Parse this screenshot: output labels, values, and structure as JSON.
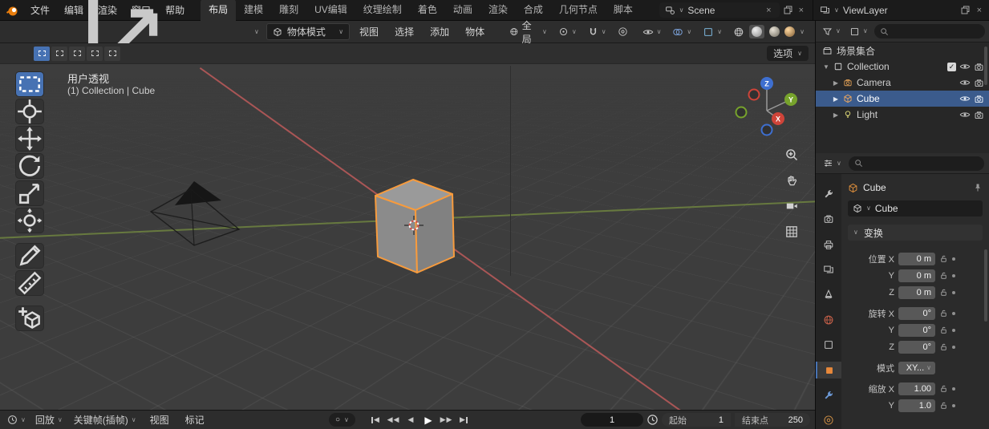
{
  "colors": {
    "accent": "#4772b3",
    "object_orange": "#e8883a",
    "selection_outline": "#f79b3d",
    "axis_x": "#cf4439",
    "axis_y": "#77a32c",
    "axis_z": "#3e6fd0"
  },
  "icons": {
    "chevron": "∨",
    "caret_open": "▼",
    "caret_closed": "▶",
    "close": "×",
    "check": "✓",
    "circle": "○",
    "tri_left": "◀",
    "tri_right": "▶"
  },
  "topbar": {
    "menus": [
      "文件",
      "编辑",
      "渲染",
      "窗口",
      "帮助"
    ],
    "tabs": [
      "布局",
      "建模",
      "雕刻",
      "UV编辑",
      "纹理绘制",
      "着色",
      "动画",
      "渲染",
      "合成",
      "几何节点",
      "脚本"
    ],
    "active_tab": "布局",
    "scene_label": "Scene",
    "viewlayer_label": "ViewLayer"
  },
  "toolbar": {
    "mode_label": "物体模式",
    "menus": [
      "视图",
      "选择",
      "添加",
      "物体"
    ],
    "orientation_label": "全局"
  },
  "viewport": {
    "title": "用户透视",
    "subtitle": "(1) Collection | Cube",
    "options_label": "选项",
    "axis_labels": {
      "x": "X",
      "y": "Y",
      "z": "Z"
    }
  },
  "outliner": {
    "scene_collection": "场景集合",
    "items": [
      {
        "label": "Collection"
      },
      {
        "label": "Camera"
      },
      {
        "label": "Cube",
        "selected": true
      },
      {
        "label": "Light"
      }
    ]
  },
  "properties": {
    "breadcrumb": "Cube",
    "name_value": "Cube",
    "transform_section": "变换",
    "rows": [
      {
        "label": "位置 X",
        "value": "0 m"
      },
      {
        "label": "Y",
        "value": "0 m"
      },
      {
        "label": "Z",
        "value": "0 m"
      },
      {
        "label": "旋转 X",
        "value": "0°"
      },
      {
        "label": "Y",
        "value": "0°"
      },
      {
        "label": "Z",
        "value": "0°"
      },
      {
        "label": "模式",
        "value": "XY..."
      },
      {
        "label": "缩放 X",
        "value": "1.00"
      },
      {
        "label": "Y",
        "value": "1.0"
      }
    ]
  },
  "timeline": {
    "menus": [
      "回放",
      "关键帧(插帧)",
      "视图",
      "标记"
    ],
    "frame_current": "1",
    "start_label": "起始",
    "start_value": "1",
    "end_label": "结束点",
    "end_value": "250"
  }
}
